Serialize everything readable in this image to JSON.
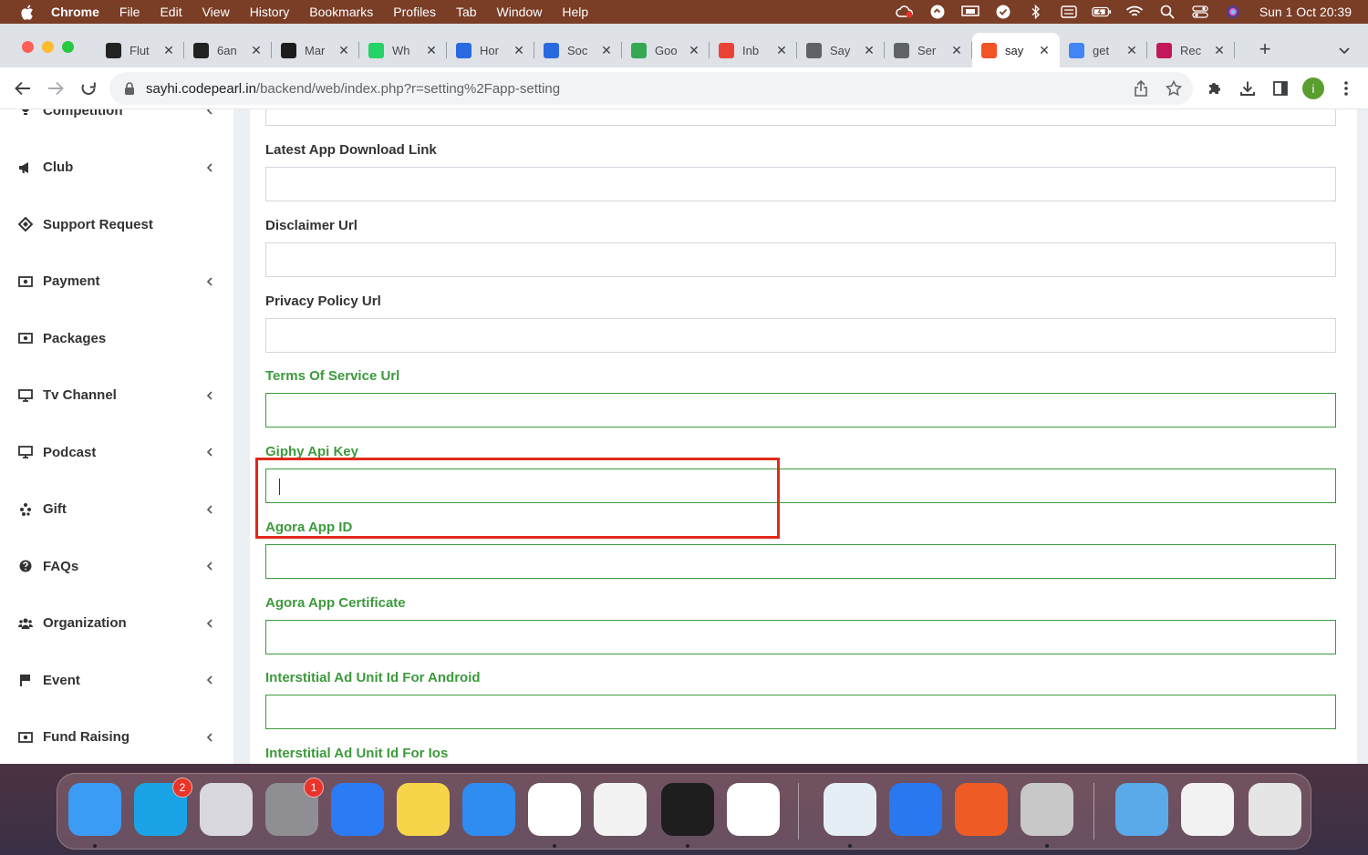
{
  "menubar": {
    "app_name": "Chrome",
    "items": [
      "File",
      "Edit",
      "View",
      "History",
      "Bookmarks",
      "Profiles",
      "Tab",
      "Window",
      "Help"
    ],
    "clock": "Sun 1 Oct  20:39"
  },
  "tabs": [
    {
      "title": "Flut",
      "favicon_color": "#222222",
      "favicon": "flutter-favicon-icon"
    },
    {
      "title": "6an",
      "favicon_color": "#222222",
      "favicon": "flutter-favicon-icon"
    },
    {
      "title": "Mar",
      "favicon_color": "#1c1c1c",
      "favicon": "app-favicon-icon"
    },
    {
      "title": "Wh",
      "favicon_color": "#25d366",
      "favicon": "whatsapp-favicon-icon"
    },
    {
      "title": "Hor",
      "favicon_color": "#2a6ae0",
      "favicon": "c-favicon-icon"
    },
    {
      "title": "Soc",
      "favicon_color": "#2a6ae0",
      "favicon": "c-favicon-icon"
    },
    {
      "title": "Goo",
      "favicon_color": "#34a853",
      "favicon": "google-meet-favicon-icon"
    },
    {
      "title": "Inb",
      "favicon_color": "#ea4335",
      "favicon": "gmail-favicon-icon"
    },
    {
      "title": "Say",
      "favicon_color": "#5f6368",
      "favicon": "globe-favicon-icon"
    },
    {
      "title": "Ser",
      "favicon_color": "#5f6368",
      "favicon": "globe-favicon-icon"
    },
    {
      "title": "say",
      "favicon_color": "#f35325",
      "favicon": "grid-favicon-icon",
      "active": true
    },
    {
      "title": "get",
      "favicon_color": "#4285f4",
      "favicon": "google-favicon-icon"
    },
    {
      "title": "Rec",
      "favicon_color": "#c2185b",
      "favicon": "app-favicon-icon"
    }
  ],
  "address_bar": {
    "host": "sayhi.codepearl.in",
    "path": "/backend/web/index.php?r=setting%2Fapp-setting"
  },
  "profile_initial": "i",
  "sidebar": {
    "items": [
      {
        "label": "Competition",
        "icon": "trophy-icon",
        "has_chevron": true
      },
      {
        "label": "Club",
        "icon": "bullhorn-icon",
        "has_chevron": true
      },
      {
        "label": "Support Request",
        "icon": "ticket-icon",
        "has_chevron": false
      },
      {
        "label": "Payment",
        "icon": "money-icon",
        "has_chevron": true
      },
      {
        "label": "Packages",
        "icon": "money-icon",
        "has_chevron": false
      },
      {
        "label": "Tv Channel",
        "icon": "desktop-icon",
        "has_chevron": true
      },
      {
        "label": "Podcast",
        "icon": "desktop-icon",
        "has_chevron": true
      },
      {
        "label": "Gift",
        "icon": "gift-icon",
        "has_chevron": true
      },
      {
        "label": "FAQs",
        "icon": "question-circle-icon",
        "has_chevron": true
      },
      {
        "label": "Organization",
        "icon": "users-icon",
        "has_chevron": true
      },
      {
        "label": "Event",
        "icon": "flag-icon",
        "has_chevron": true
      },
      {
        "label": "Fund Raising",
        "icon": "money-icon",
        "has_chevron": true
      }
    ]
  },
  "form": {
    "partial_top_value": "30",
    "fields": [
      {
        "label": "Latest App Download Link",
        "value": "",
        "state": "default"
      },
      {
        "label": "Disclaimer Url",
        "value": "",
        "state": "default"
      },
      {
        "label": "Privacy Policy Url",
        "value": "",
        "state": "default"
      },
      {
        "label": "Terms Of Service Url",
        "value": "",
        "state": "valid"
      },
      {
        "label": "Giphy Api Key",
        "value": "",
        "state": "focused"
      },
      {
        "label": "Agora App ID",
        "value": "",
        "state": "valid"
      },
      {
        "label": "Agora App Certificate",
        "value": "",
        "state": "valid"
      },
      {
        "label": "Interstitial Ad Unit Id For Android",
        "value": "",
        "state": "valid"
      },
      {
        "label": "Interstitial Ad Unit Id For Ios",
        "value": "",
        "state": "valid"
      }
    ]
  },
  "colors": {
    "valid_green": "#3c9a3c",
    "highlight_red": "#e0291c"
  },
  "dock": {
    "apps": [
      {
        "name": "finder-icon",
        "color": "#3b9cf5",
        "running": true
      },
      {
        "name": "skype-icon",
        "color": "#1aa3e6",
        "badge": "2",
        "running": false
      },
      {
        "name": "launchpad-icon",
        "color": "#d8d8de",
        "running": false
      },
      {
        "name": "system-preferences-icon",
        "color": "#8e8e93",
        "badge": "1",
        "running": false
      },
      {
        "name": "xcode-icon",
        "color": "#2b7cf4",
        "running": false
      },
      {
        "name": "notes-icon",
        "color": "#f7d54a",
        "running": false
      },
      {
        "name": "safari-icon",
        "color": "#2f8cf0",
        "running": false
      },
      {
        "name": "chrome-icon",
        "color": "#ffffff",
        "running": true
      },
      {
        "name": "textedit-icon",
        "color": "#f2f2f2",
        "running": false
      },
      {
        "name": "figma-icon",
        "color": "#1e1e1e",
        "running": true
      },
      {
        "name": "app-store-icon",
        "color": "#ffffff",
        "running": false
      },
      {
        "name": "preview-icon",
        "color": "#e6eef5",
        "running": true
      },
      {
        "name": "screen-time-icon",
        "color": "#2978f0",
        "running": false
      },
      {
        "name": "postman-icon",
        "color": "#ef5b25",
        "running": false
      },
      {
        "name": "chrome-apps-icon",
        "color": "#c8c8c8",
        "running": true
      },
      {
        "name": "downloads-folder-icon",
        "color": "#5aa9e8",
        "running": false
      },
      {
        "name": "screenshot-thumbnail-icon",
        "color": "#f2f2f2",
        "running": false
      },
      {
        "name": "trash-icon",
        "color": "#e5e5e5",
        "running": false
      }
    ]
  }
}
